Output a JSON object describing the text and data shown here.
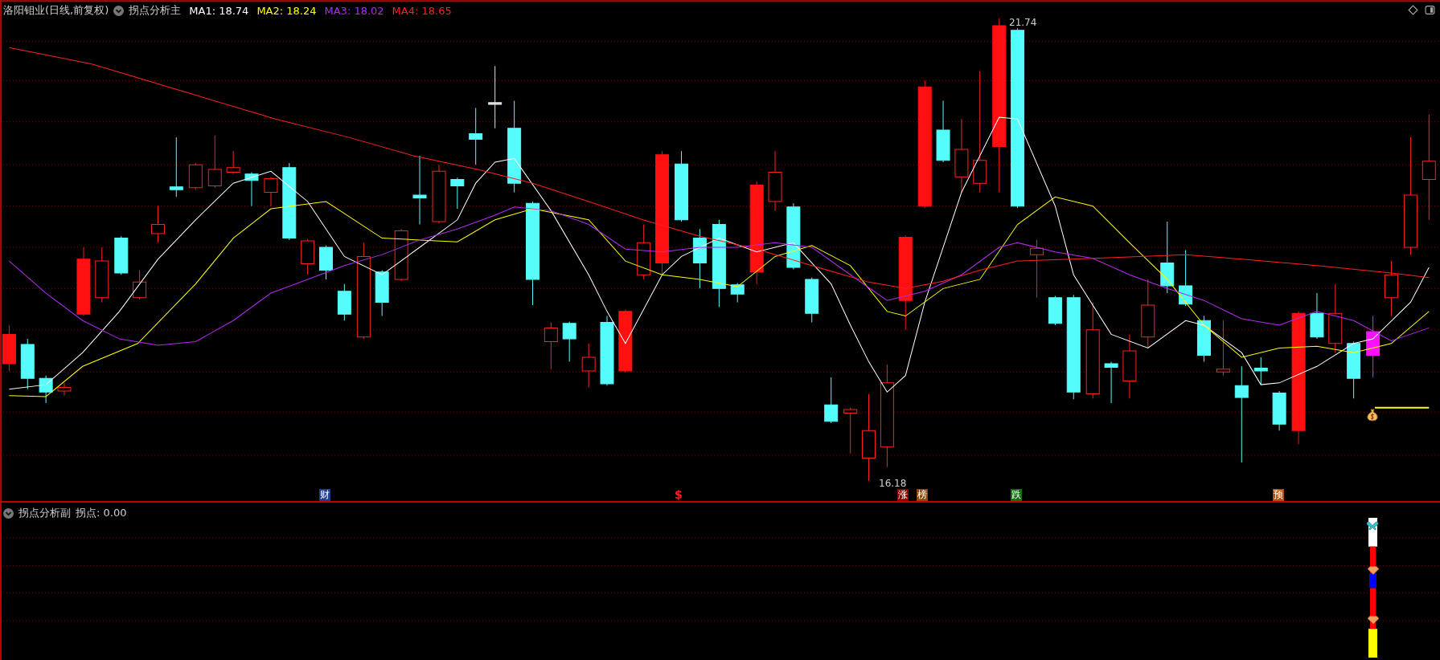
{
  "main_panel": {
    "stock_name": "洛阳钼业(日线,前复权)",
    "indicator_name": "拐点分析主",
    "moving_averages": [
      {
        "label": "MA1: 18.74",
        "color": "#ffffff"
      },
      {
        "label": "MA2: 18.24",
        "color": "#ffff00"
      },
      {
        "label": "MA3: 18.02",
        "color": "#b22cf0"
      },
      {
        "label": "MA4: 18.65",
        "color": "#ff2020"
      }
    ],
    "price_labels": [
      {
        "kind": "high",
        "text": "21.74"
      },
      {
        "kind": "low",
        "text": "16.18"
      }
    ],
    "signal_markers": [
      {
        "kind": "badge",
        "text": "财",
        "color": "#1c3c8c"
      },
      {
        "kind": "text",
        "text": "$",
        "color": "#ff2020"
      },
      {
        "kind": "badge",
        "text": "涨",
        "color": "#8b0000"
      },
      {
        "kind": "badge",
        "text": "榜",
        "color": "#8b4a10"
      },
      {
        "kind": "badge",
        "text": "跌",
        "color": "#107010"
      },
      {
        "kind": "badge",
        "text": "预",
        "color": "#b0500a"
      }
    ]
  },
  "sub_panel": {
    "indicator_name": "拐点分析副",
    "reading": "拐点: 0.00"
  }
}
